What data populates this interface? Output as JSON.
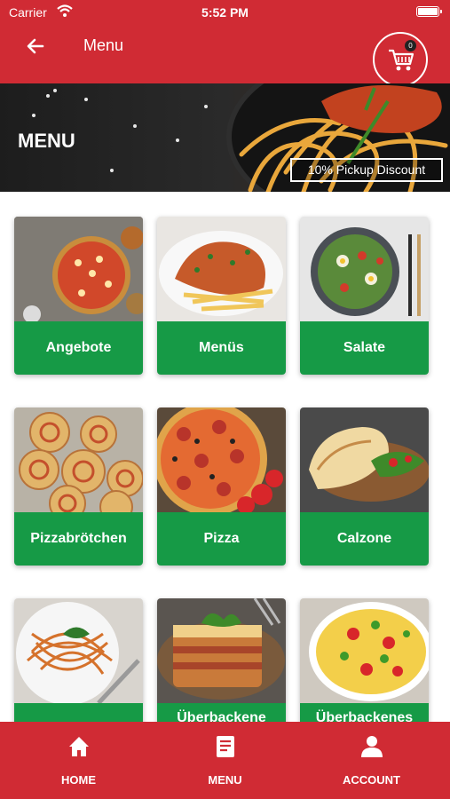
{
  "status_bar": {
    "carrier": "Carrier",
    "time": "5:52 PM"
  },
  "nav": {
    "title": "Menu",
    "cart_count": "0"
  },
  "hero": {
    "heading": "MENU",
    "badge": "10% Pickup Discount"
  },
  "categories": [
    {
      "label": "Angebote"
    },
    {
      "label": "Menüs"
    },
    {
      "label": "Salate"
    },
    {
      "label": "Pizzabrötchen"
    },
    {
      "label": "Pizza"
    },
    {
      "label": "Calzone"
    },
    {
      "label": ""
    },
    {
      "label": "Überbackene"
    },
    {
      "label": "Überbackenes"
    }
  ],
  "tabs": [
    {
      "label": "HOME",
      "icon": "home-icon"
    },
    {
      "label": "MENU",
      "icon": "menu-book-icon"
    },
    {
      "label": "ACCOUNT",
      "icon": "account-icon"
    }
  ],
  "colors": {
    "brand_red": "#d02b34",
    "accent_green": "#169a46"
  }
}
